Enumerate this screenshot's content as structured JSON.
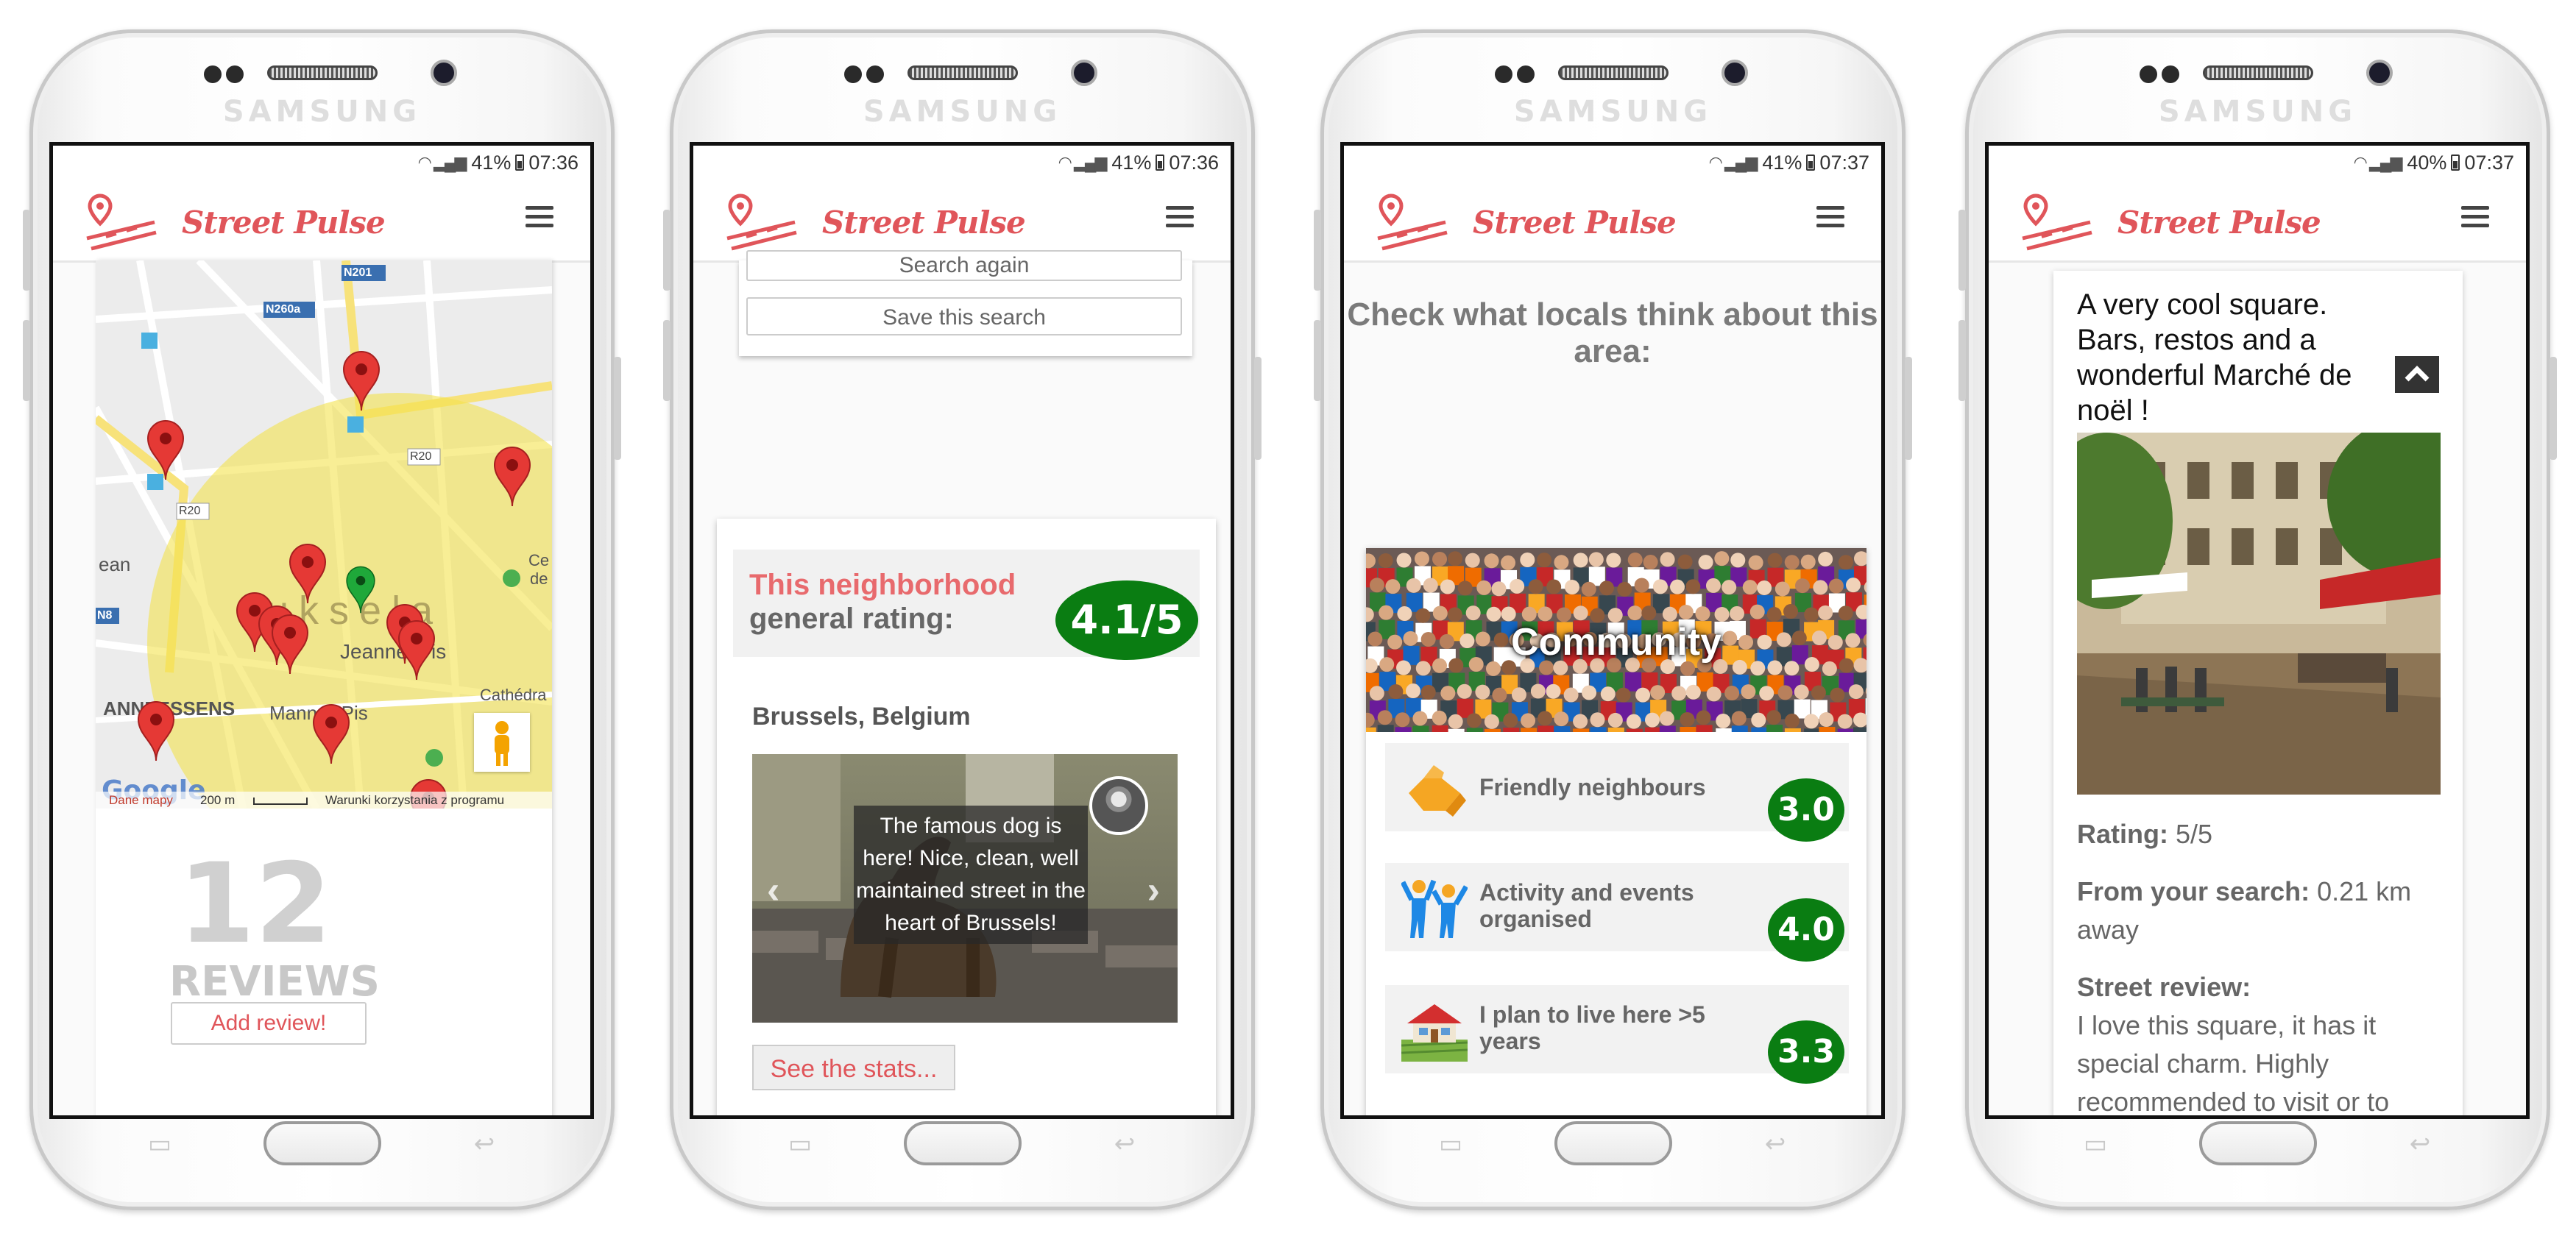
{
  "app": {
    "brand": "SAMSUNG",
    "title": "Street Pulse",
    "accent_color": "#e0555a",
    "rating_color": "#0a7d12"
  },
  "screens": [
    {
      "status": {
        "battery": "41%",
        "time": "07:36"
      },
      "map": {
        "road_labels": [
          "N201",
          "N260a",
          "R20",
          "R20",
          "N8"
        ],
        "area_labels": [
          "uksela",
          "Jeanne",
          "-Pis",
          "ANNEESSENS",
          "Manne",
          "n Pis",
          "Cathédra",
          "Ce",
          "de",
          "ean"
        ],
        "attribution": {
          "google": "Google",
          "data": "Dane mapy",
          "scale": "200 m",
          "terms": "Warunki korzystania z programu"
        },
        "pegman_icon": "pegman-icon",
        "marker_icon": "map-marker-icon"
      },
      "reviews": {
        "count": "12",
        "label": "REVIEWS",
        "add_button": "Add review!"
      }
    },
    {
      "status": {
        "battery": "41%",
        "time": "07:36"
      },
      "search": {
        "search_again": "Search again",
        "save_search": "Save this search"
      },
      "rating": {
        "title": "This neighborhood",
        "subtitle": "general rating:",
        "value": "4.1/5"
      },
      "location": "Brussels, Belgium",
      "review_caption": "The famous dog is here! Nice, clean, well maintained street in the heart of Brussels!",
      "prev_icon": "chevron-left-icon",
      "next_icon": "chevron-right-icon",
      "see_stats": "See the stats..."
    },
    {
      "status": {
        "battery": "41%",
        "time": "07:37"
      },
      "heading": "Check what locals think about this area:",
      "category": "Community",
      "stats": [
        {
          "label": "Friendly neighbours",
          "value": "3.0",
          "icon": "handshake-icon"
        },
        {
          "label": "Activity and events organised",
          "value": "4.0",
          "icon": "celebrating-people-icon"
        },
        {
          "label": "I plan to live here >5 years",
          "value": "3.3",
          "icon": "house-icon"
        }
      ]
    },
    {
      "status": {
        "battery": "40%",
        "time": "07:37"
      },
      "title": "A very cool square. Bars, restos and a wonderful Marché de noël !",
      "collapse_icon": "chevron-up-icon",
      "rating_label": "Rating:",
      "rating_value": "5/5",
      "distance_label": "From your search:",
      "distance_value": "0.21 km away",
      "review_label": "Street review:",
      "review_text": "I love this square, it has it special charm. Highly recommended to visit or to"
    }
  ]
}
